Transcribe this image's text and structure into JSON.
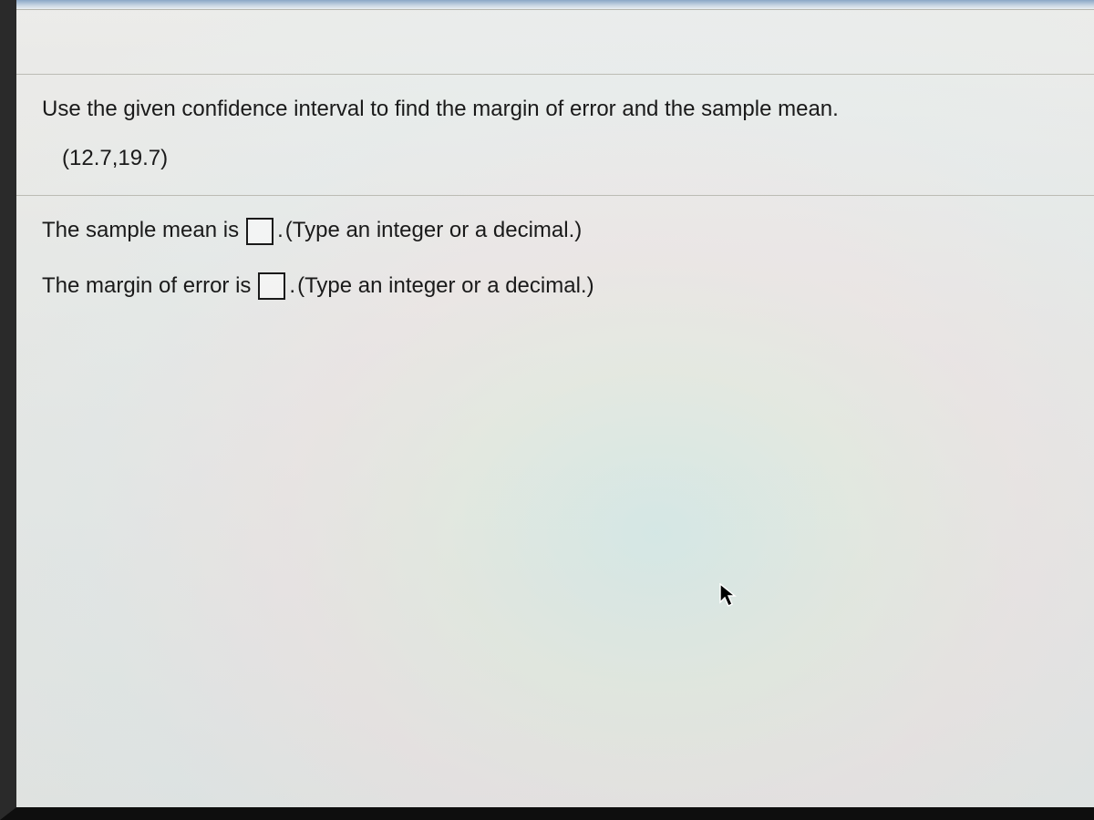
{
  "question": {
    "prompt": "Use the given confidence interval to find the margin of error and the sample mean.",
    "interval": "(12.7,19.7)"
  },
  "answers": {
    "sample_mean": {
      "label": "The sample mean is",
      "period": ".",
      "hint": "(Type an integer or a decimal.)",
      "value": ""
    },
    "margin_of_error": {
      "label": "The margin of error is",
      "period": ".",
      "hint": "(Type an integer or a decimal.)",
      "value": ""
    }
  }
}
